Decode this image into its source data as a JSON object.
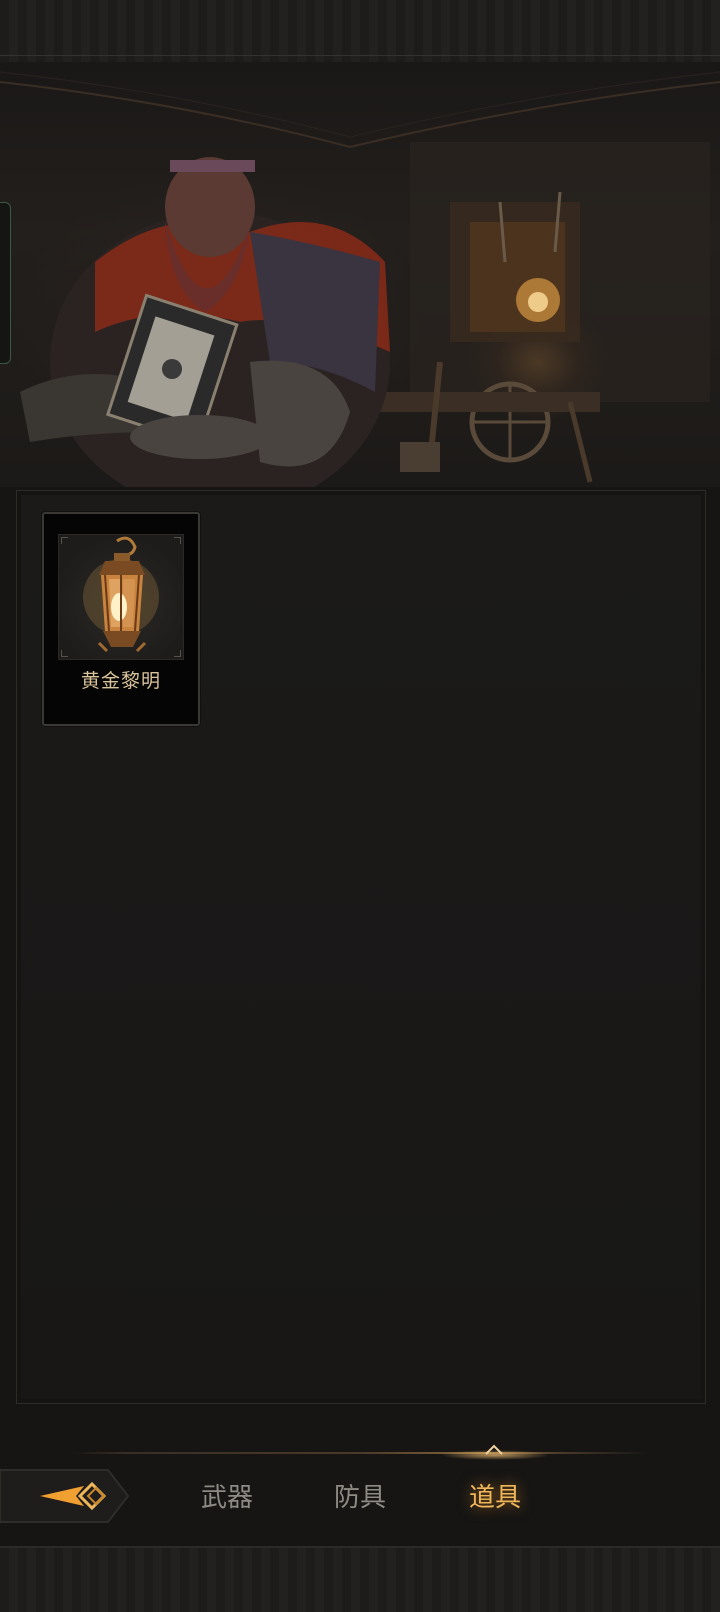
{
  "item": {
    "name": "黄金黎明",
    "icon": "lantern-icon"
  },
  "tabs": [
    {
      "label": "武器",
      "active": false
    },
    {
      "label": "防具",
      "active": false
    },
    {
      "label": "道具",
      "active": true
    }
  ],
  "back": {
    "icon": "back-arrow-icon"
  },
  "colors": {
    "accent": "#f0b75a",
    "tab_inactive": "#8e8a84",
    "item_name": "#d9c39a",
    "background": "#161514"
  }
}
